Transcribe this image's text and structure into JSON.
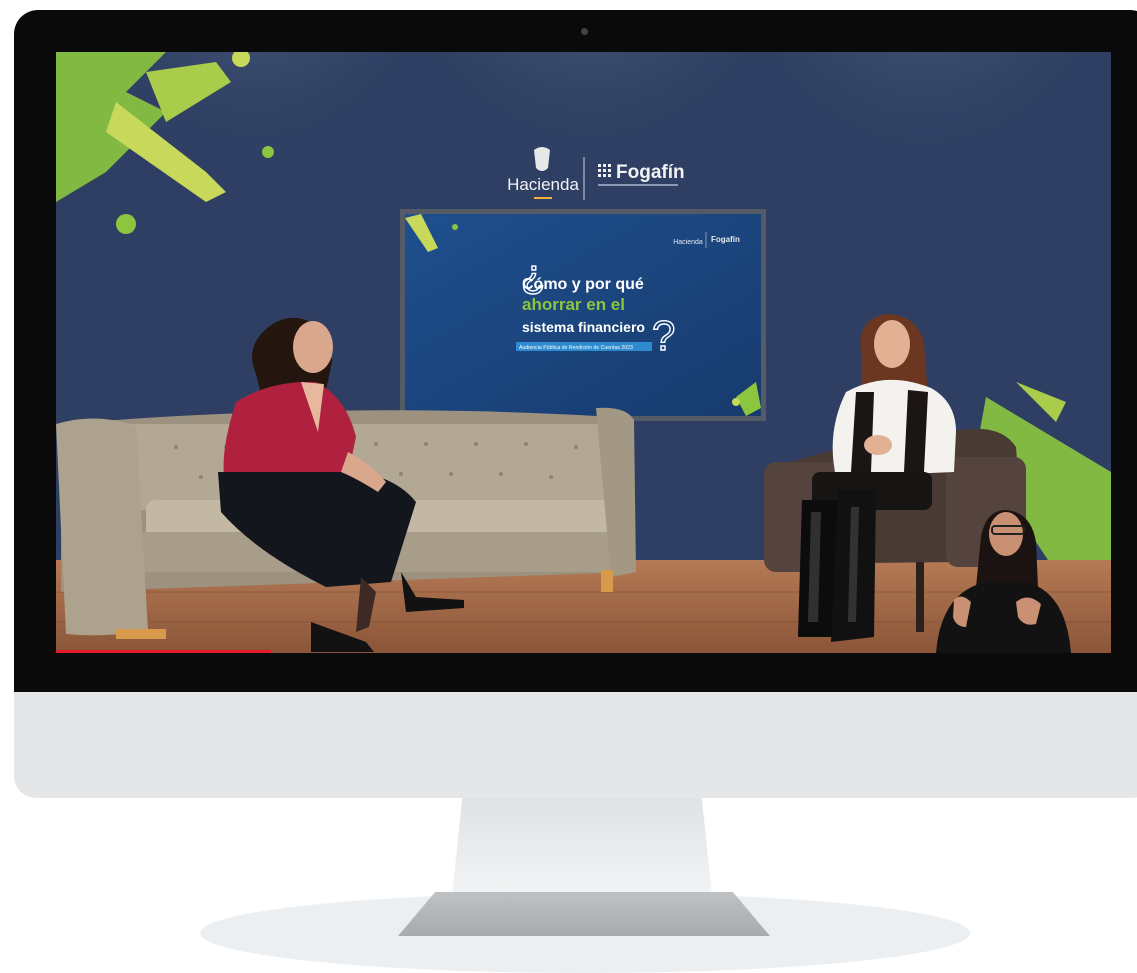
{
  "studio": {
    "brand_hacienda": "Hacienda",
    "brand_fogafin": "Fogafín"
  },
  "tv_screen": {
    "brand_hacienda": "Hacienda",
    "brand_fogafin": "Fogafín",
    "title_line1": "Cómo y por qué",
    "title_line2": "ahorrar en el",
    "title_line3": "sistema financiero",
    "subtitle": "Audiencia Pública de Rendición de Cuentas 2023"
  },
  "colors": {
    "wall": "#2e3f63",
    "accent_green": "#8cc63f",
    "accent_lime": "#c8d85a",
    "floor": "#a0684a",
    "screen_blue": "#1e4a86",
    "sofa": "#b3a894",
    "blouse_red": "#b0203f"
  }
}
